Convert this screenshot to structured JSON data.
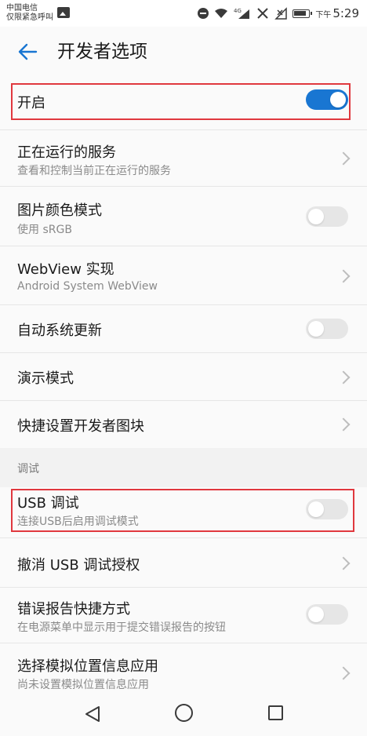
{
  "status_bar": {
    "carrier_line1": "中国电信",
    "carrier_line2": "仅限紧急呼叫",
    "signal_tag": "4G",
    "time_prefix": "下午",
    "time": "5:29"
  },
  "header": {
    "title": "开发者选项"
  },
  "master_switch": {
    "label": "开启",
    "on": true
  },
  "items": [
    {
      "title": "正在运行的服务",
      "subtitle": "查看和控制当前正在运行的服务",
      "control": "chevron"
    },
    {
      "title": "图片颜色模式",
      "subtitle": "使用 sRGB",
      "control": "toggle",
      "on": false
    },
    {
      "title": "WebView 实现",
      "subtitle": "Android System WebView",
      "control": "chevron"
    },
    {
      "title": "自动系统更新",
      "control": "toggle",
      "on": false
    },
    {
      "title": "演示模式",
      "control": "chevron"
    },
    {
      "title": "快捷设置开发者图块",
      "control": "chevron"
    }
  ],
  "debug_section": {
    "header": "调试",
    "items": [
      {
        "title": "USB 调试",
        "subtitle": "连接USB后启用调试模式",
        "control": "toggle",
        "on": false
      },
      {
        "title": "撤消 USB 调试授权",
        "control": "chevron"
      },
      {
        "title": "错误报告快捷方式",
        "subtitle": "在电源菜单中显示用于提交错误报告的按钮",
        "control": "toggle",
        "on": false
      },
      {
        "title": "选择模拟位置信息应用",
        "subtitle": "尚未设置模拟位置信息应用",
        "control": "chevron"
      }
    ]
  },
  "colors": {
    "accent": "#1976d2",
    "highlight": "#e0383e",
    "toggle_off": "#e6e6e6"
  }
}
